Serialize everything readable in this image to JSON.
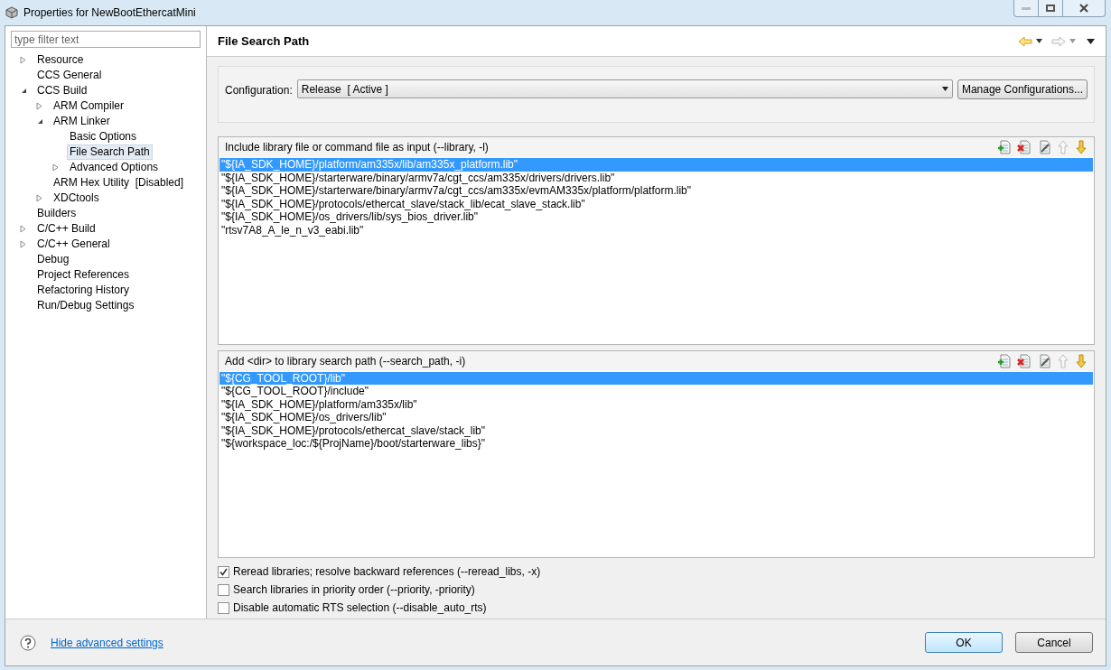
{
  "window": {
    "title": "Properties for NewBootEthercatMini"
  },
  "filter": {
    "placeholder": "type filter text"
  },
  "tree": [
    {
      "label": "Resource",
      "expanded": false,
      "selected": false
    },
    {
      "label": "CCS General",
      "selected": false
    },
    {
      "label": "CCS Build",
      "expanded": true,
      "selected": false,
      "children": [
        {
          "label": "ARM Compiler",
          "expanded": false,
          "selected": false
        },
        {
          "label": "ARM Linker",
          "expanded": true,
          "selected": false,
          "children": [
            {
              "label": "Basic Options",
              "selected": false
            },
            {
              "label": "File Search Path",
              "selected": true
            },
            {
              "label": "Advanced Options",
              "expanded": false,
              "selected": false
            }
          ]
        },
        {
          "label": "ARM Hex Utility  [Disabled]",
          "selected": false
        },
        {
          "label": "XDCtools",
          "expanded": false,
          "selected": false
        }
      ]
    },
    {
      "label": "Builders",
      "selected": false
    },
    {
      "label": "C/C++ Build",
      "expanded": false,
      "selected": false
    },
    {
      "label": "C/C++ General",
      "expanded": false,
      "selected": false
    },
    {
      "label": "Debug",
      "selected": false
    },
    {
      "label": "Project References",
      "selected": false
    },
    {
      "label": "Refactoring History",
      "selected": false
    },
    {
      "label": "Run/Debug Settings",
      "selected": false
    }
  ],
  "page": {
    "title": "File Search Path"
  },
  "configuration": {
    "label": "Configuration:",
    "value": "Release  [ Active ]",
    "manage_button": "Manage Configurations..."
  },
  "lists": [
    {
      "title": "Include library file or command file as input (--library, -l)",
      "items": [
        {
          "text": "\"${IA_SDK_HOME}/platform/am335x/lib/am335x_platform.lib\"",
          "selected": true
        },
        {
          "text": "\"${IA_SDK_HOME}/starterware/binary/armv7a/cgt_ccs/am335x/drivers/drivers.lib\"",
          "selected": false
        },
        {
          "text": "\"${IA_SDK_HOME}/starterware/binary/armv7a/cgt_ccs/am335x/evmAM335x/platform/platform.lib\"",
          "selected": false
        },
        {
          "text": "\"${IA_SDK_HOME}/protocols/ethercat_slave/stack_lib/ecat_slave_stack.lib\"",
          "selected": false
        },
        {
          "text": "\"${IA_SDK_HOME}/os_drivers/lib/sys_bios_driver.lib\"",
          "selected": false
        },
        {
          "text": "\"rtsv7A8_A_le_n_v3_eabi.lib\"",
          "selected": false
        }
      ]
    },
    {
      "title": "Add <dir> to library search path (--search_path, -i)",
      "items": [
        {
          "text": "\"${CG_TOOL_ROOT}/lib\"",
          "selected": true
        },
        {
          "text": "\"${CG_TOOL_ROOT}/include\"",
          "selected": false
        },
        {
          "text": "\"${IA_SDK_HOME}/platform/am335x/lib\"",
          "selected": false
        },
        {
          "text": "\"${IA_SDK_HOME}/os_drivers/lib\"",
          "selected": false
        },
        {
          "text": "\"${IA_SDK_HOME}/protocols/ethercat_slave/stack_lib\"",
          "selected": false
        },
        {
          "text": "\"${workspace_loc:/${ProjName}/boot/starterware_libs}\"",
          "selected": false
        }
      ]
    }
  ],
  "options": [
    {
      "label": "Reread libraries; resolve backward references (--reread_libs, -x)",
      "checked": true
    },
    {
      "label": "Search libraries in priority order (--priority, -priority)",
      "checked": false
    },
    {
      "label": "Disable automatic RTS selection (--disable_auto_rts)",
      "checked": false
    }
  ],
  "footer": {
    "link": "Hide advanced settings",
    "ok": "OK",
    "cancel": "Cancel"
  }
}
